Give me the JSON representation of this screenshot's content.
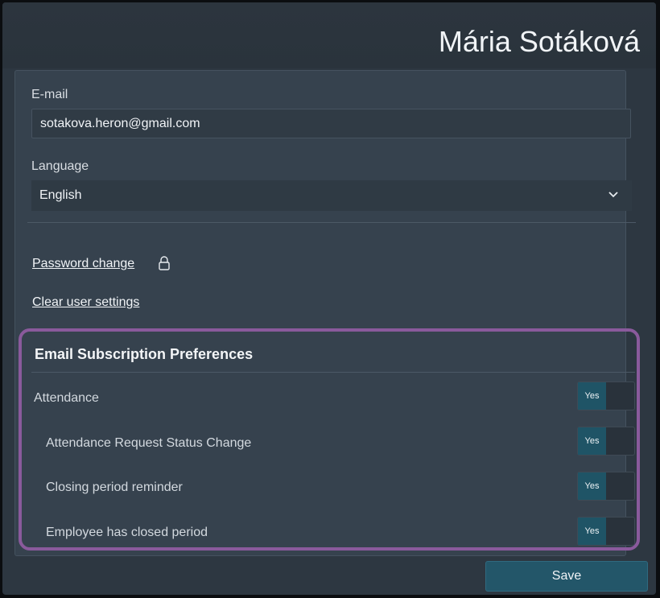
{
  "header": {
    "user_name": "Mária Sotáková"
  },
  "form": {
    "email_label": "E-mail",
    "email_value": "sotakova.heron@gmail.com",
    "language_label": "Language",
    "language_value": "English",
    "password_change_link": "Password change",
    "clear_settings_link": "Clear user settings"
  },
  "subscriptions": {
    "title": "Email Subscription Preferences",
    "items": [
      {
        "label": "Attendance",
        "toggle": "Yes",
        "on": true
      },
      {
        "label": "Attendance Request Status Change",
        "toggle": "Yes",
        "on": true
      },
      {
        "label": "Closing period reminder",
        "toggle": "Yes",
        "on": true
      },
      {
        "label": "Employee has closed period",
        "toggle": "Yes",
        "on": true
      }
    ]
  },
  "footer": {
    "save_label": "Save"
  },
  "icons": {
    "chevron": "chevron-down-icon",
    "lock": "lock-icon"
  },
  "colors": {
    "accent": "#235669",
    "highlight_border": "#8a5a9c"
  }
}
